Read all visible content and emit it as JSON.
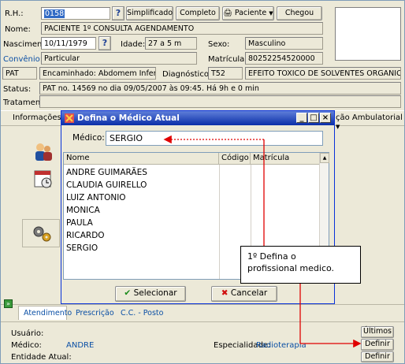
{
  "header": {
    "rh_label": "R.H.:",
    "rh_value": "0158",
    "buttons": {
      "simplificado": "Simplificado",
      "completo": "Completo",
      "paciente": "Paciente",
      "chegou": "Chegou"
    },
    "nome_label": "Nome:",
    "nome_value": "PACIENTE 1º CONSULTA AGENDAMENTO",
    "nascimento_label": "Nascimento:",
    "nascimento_value": "10/11/1979",
    "idade_label": "Idade:",
    "idade_value": "27 a 5 m",
    "sexo_label": "Sexo:",
    "sexo_value": "Masculino",
    "convenio_label": "Convênio:",
    "convenio_value": "Particular",
    "matricula_label": "Matrícula:",
    "matricula_value": "80252254520000",
    "pat_label": "PAT",
    "encaminhado_value": "Encaminhado: Abdomem Inferior",
    "diagnostico_label": "Diagnóstico:",
    "diagnostico_code": "T52",
    "diagnostico_desc": "EFEITO TOXICO DE SOLVENTES ORGANICOS",
    "status_label": "Status:",
    "status_value": "PAT no. 14569 no dia 09/05/2007  às  09:45. Há 9h e 0 min",
    "tratamento_label": "Tratamento:"
  },
  "menubar": {
    "informacoes": "Informações",
    "ambulatorial": "ção Ambulatorial"
  },
  "dialog": {
    "title": "Defina o Médico Atual",
    "medico_label": "Médico:",
    "medico_value": "SERGIO",
    "columns": [
      "Nome",
      "Código",
      "Matrícula"
    ],
    "rows": [
      "ANDRE GUIMARÃES",
      "CLAUDIA GUIRELLO",
      "LUIZ ANTONIO",
      "MONICA",
      "PAULA",
      "RICARDO",
      "SERGIO"
    ],
    "select_label": "Selecionar",
    "cancel_label": "Cancelar"
  },
  "callout": {
    "line1": "1º Defina o",
    "line2": "profissional medico."
  },
  "tabs": [
    "Atendimento",
    "Prescrição",
    "C.C. - Posto"
  ],
  "footer": {
    "usuario_label": "Usuário:",
    "medico_label": "Médico:",
    "medico_value": "ANDRE",
    "entidade_label": "Entidade Atual:",
    "especialidade_label": "Especialidade:",
    "especialidade_value": "Radioterapia",
    "ultimos_button": "Últimos",
    "definir_button": "Definir"
  },
  "colors": {
    "arrow": "#e00000",
    "title_bar": "#0a2ea8",
    "link_blue": "#0a4fa5"
  }
}
